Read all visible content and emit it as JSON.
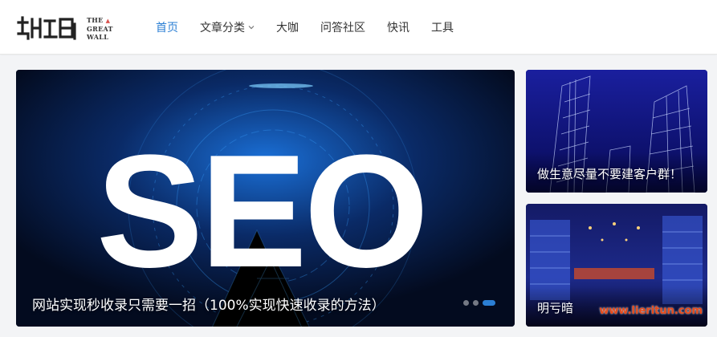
{
  "brand": {
    "logo_line1": "THE",
    "logo_line2": "GREAT",
    "logo_line3": "WALL"
  },
  "nav": {
    "items": [
      {
        "label": "首页",
        "active": true
      },
      {
        "label": "文章分类",
        "has_dropdown": true
      },
      {
        "label": "大咖"
      },
      {
        "label": "问答社区"
      },
      {
        "label": "快讯"
      },
      {
        "label": "工具"
      }
    ]
  },
  "slider": {
    "big_text": "SEO",
    "caption": "网站实现秒收录只需要一招（100%实现快速收录的方法）",
    "dot_count": 3,
    "active_dot": 3
  },
  "side_cards": [
    {
      "title": "做生意尽量不要建客户群！"
    },
    {
      "title": "明亏暗",
      "watermark": "www.lieritun.com"
    }
  ],
  "colors": {
    "accent": "#2b7fd4",
    "header_bg": "#ffffff",
    "page_bg": "#f3f4f6",
    "watermark": "#e84a1a"
  }
}
